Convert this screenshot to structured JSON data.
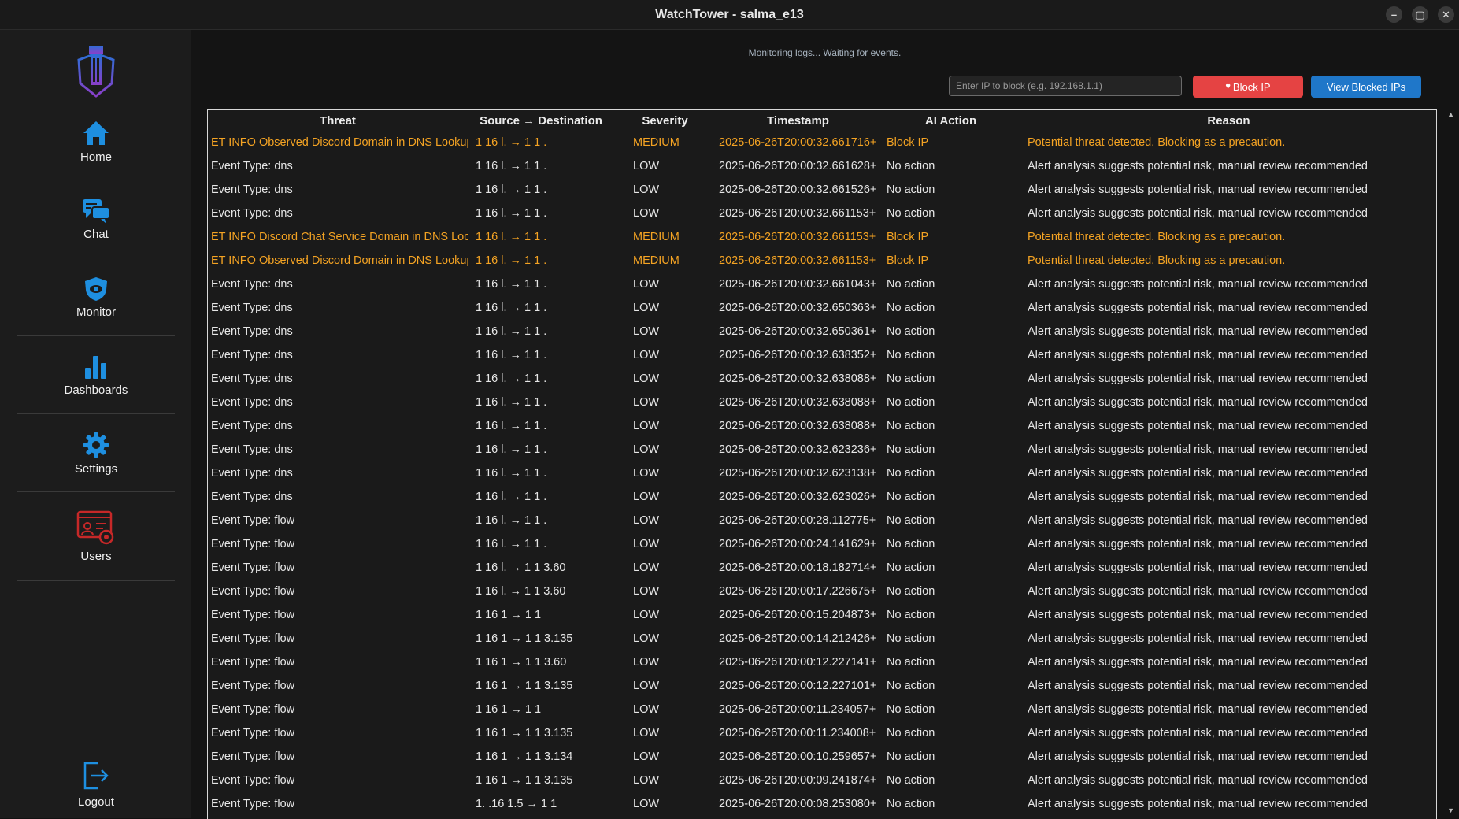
{
  "window": {
    "title": "WatchTower - salma_e13",
    "controls": [
      "–",
      "▢",
      "✕"
    ]
  },
  "sidebar": {
    "items": [
      {
        "label": "Home",
        "icon": "home-icon"
      },
      {
        "label": "Chat",
        "icon": "chat-icon"
      },
      {
        "label": "Monitor",
        "icon": "shield-eye-icon"
      },
      {
        "label": "Dashboards",
        "icon": "bar-chart-icon"
      },
      {
        "label": "Settings",
        "icon": "gear-icon"
      },
      {
        "label": "Users",
        "icon": "users-admin-icon"
      }
    ],
    "logout": {
      "label": "Logout",
      "icon": "logout-icon"
    }
  },
  "main": {
    "status": "Monitoring logs... Waiting for events.",
    "ip_input": {
      "placeholder": "Enter IP to block (e.g. 192.168.1.1)",
      "value": ""
    },
    "block_button": "Block IP",
    "view_button": "View Blocked IPs",
    "colors": {
      "medium": "#f4a323",
      "block": "#e54343",
      "view": "#1f77c9"
    }
  },
  "table": {
    "headers": [
      "Threat",
      "Source → Destination",
      "Severity",
      "Timestamp",
      "AI Action",
      "Reason"
    ],
    "rows": [
      {
        "threat": "ET INFO Observed Discord Domain in DNS Lookup",
        "src_dst": "1 16 l. → 1 1 .",
        "severity": "MEDIUM",
        "timestamp": "2025-06-26T20:00:32.661716+",
        "action": "Block IP",
        "reason": "Potential threat detected. Blocking as a precaution."
      },
      {
        "threat": "Event Type: dns",
        "src_dst": "1 16 l. → 1 1 .",
        "severity": "LOW",
        "timestamp": "2025-06-26T20:00:32.661628+",
        "action": "No action",
        "reason": "Alert analysis suggests potential risk, manual review recommended"
      },
      {
        "threat": "Event Type: dns",
        "src_dst": "1 16 l. → 1 1 .",
        "severity": "LOW",
        "timestamp": "2025-06-26T20:00:32.661526+",
        "action": "No action",
        "reason": "Alert analysis suggests potential risk, manual review recommended"
      },
      {
        "threat": "Event Type: dns",
        "src_dst": "1 16 l. → 1 1 .",
        "severity": "LOW",
        "timestamp": "2025-06-26T20:00:32.661153+",
        "action": "No action",
        "reason": "Alert analysis suggests potential risk, manual review recommended"
      },
      {
        "threat": "ET INFO Discord Chat Service Domain in DNS Lookup",
        "src_dst": "1 16 l. → 1 1 .",
        "severity": "MEDIUM",
        "timestamp": "2025-06-26T20:00:32.661153+",
        "action": "Block IP",
        "reason": "Potential threat detected. Blocking as a precaution."
      },
      {
        "threat": "ET INFO Observed Discord Domain in DNS Lookup",
        "src_dst": "1 16 l. → 1 1 .",
        "severity": "MEDIUM",
        "timestamp": "2025-06-26T20:00:32.661153+",
        "action": "Block IP",
        "reason": "Potential threat detected. Blocking as a precaution."
      },
      {
        "threat": "Event Type: dns",
        "src_dst": "1 16 l. → 1 1 .",
        "severity": "LOW",
        "timestamp": "2025-06-26T20:00:32.661043+",
        "action": "No action",
        "reason": "Alert analysis suggests potential risk, manual review recommended"
      },
      {
        "threat": "Event Type: dns",
        "src_dst": "1 16 l. → 1 1 .",
        "severity": "LOW",
        "timestamp": "2025-06-26T20:00:32.650363+",
        "action": "No action",
        "reason": "Alert analysis suggests potential risk, manual review recommended"
      },
      {
        "threat": "Event Type: dns",
        "src_dst": "1 16 l. → 1 1 .",
        "severity": "LOW",
        "timestamp": "2025-06-26T20:00:32.650361+",
        "action": "No action",
        "reason": "Alert analysis suggests potential risk, manual review recommended"
      },
      {
        "threat": "Event Type: dns",
        "src_dst": "1 16 l. → 1 1 .",
        "severity": "LOW",
        "timestamp": "2025-06-26T20:00:32.638352+",
        "action": "No action",
        "reason": "Alert analysis suggests potential risk, manual review recommended"
      },
      {
        "threat": "Event Type: dns",
        "src_dst": "1 16 l. → 1 1 .",
        "severity": "LOW",
        "timestamp": "2025-06-26T20:00:32.638088+",
        "action": "No action",
        "reason": "Alert analysis suggests potential risk, manual review recommended"
      },
      {
        "threat": "Event Type: dns",
        "src_dst": "1 16 l. → 1 1 .",
        "severity": "LOW",
        "timestamp": "2025-06-26T20:00:32.638088+",
        "action": "No action",
        "reason": "Alert analysis suggests potential risk, manual review recommended"
      },
      {
        "threat": "Event Type: dns",
        "src_dst": "1 16 l. → 1 1 .",
        "severity": "LOW",
        "timestamp": "2025-06-26T20:00:32.638088+",
        "action": "No action",
        "reason": "Alert analysis suggests potential risk, manual review recommended"
      },
      {
        "threat": "Event Type: dns",
        "src_dst": "1 16 l. → 1 1 .",
        "severity": "LOW",
        "timestamp": "2025-06-26T20:00:32.623236+",
        "action": "No action",
        "reason": "Alert analysis suggests potential risk, manual review recommended"
      },
      {
        "threat": "Event Type: dns",
        "src_dst": "1 16 l. → 1 1 .",
        "severity": "LOW",
        "timestamp": "2025-06-26T20:00:32.623138+",
        "action": "No action",
        "reason": "Alert analysis suggests potential risk, manual review recommended"
      },
      {
        "threat": "Event Type: dns",
        "src_dst": "1 16 l. → 1 1 .",
        "severity": "LOW",
        "timestamp": "2025-06-26T20:00:32.623026+",
        "action": "No action",
        "reason": "Alert analysis suggests potential risk, manual review recommended"
      },
      {
        "threat": "Event Type: flow",
        "src_dst": "1 16 l. → 1 1 .",
        "severity": "LOW",
        "timestamp": "2025-06-26T20:00:28.112775+",
        "action": "No action",
        "reason": "Alert analysis suggests potential risk, manual review recommended"
      },
      {
        "threat": "Event Type: flow",
        "src_dst": "1 16 l. → 1 1 .",
        "severity": "LOW",
        "timestamp": "2025-06-26T20:00:24.141629+",
        "action": "No action",
        "reason": "Alert analysis suggests potential risk, manual review recommended"
      },
      {
        "threat": "Event Type: flow",
        "src_dst": "1 16 l. → 1 1 3.60",
        "severity": "LOW",
        "timestamp": "2025-06-26T20:00:18.182714+",
        "action": "No action",
        "reason": "Alert analysis suggests potential risk, manual review recommended"
      },
      {
        "threat": "Event Type: flow",
        "src_dst": "1 16 l. → 1 1 3.60",
        "severity": "LOW",
        "timestamp": "2025-06-26T20:00:17.226675+",
        "action": "No action",
        "reason": "Alert analysis suggests potential risk, manual review recommended"
      },
      {
        "threat": "Event Type: flow",
        "src_dst": "1 16 1 → 1 1",
        "severity": "LOW",
        "timestamp": "2025-06-26T20:00:15.204873+",
        "action": "No action",
        "reason": "Alert analysis suggests potential risk, manual review recommended"
      },
      {
        "threat": "Event Type: flow",
        "src_dst": "1 16 1 → 1 1 3.135",
        "severity": "LOW",
        "timestamp": "2025-06-26T20:00:14.212426+",
        "action": "No action",
        "reason": "Alert analysis suggests potential risk, manual review recommended"
      },
      {
        "threat": "Event Type: flow",
        "src_dst": "1 16 1 → 1 1 3.60",
        "severity": "LOW",
        "timestamp": "2025-06-26T20:00:12.227141+",
        "action": "No action",
        "reason": "Alert analysis suggests potential risk, manual review recommended"
      },
      {
        "threat": "Event Type: flow",
        "src_dst": "1 16 1 → 1 1 3.135",
        "severity": "LOW",
        "timestamp": "2025-06-26T20:00:12.227101+",
        "action": "No action",
        "reason": "Alert analysis suggests potential risk, manual review recommended"
      },
      {
        "threat": "Event Type: flow",
        "src_dst": "1 16 1 → 1 1",
        "severity": "LOW",
        "timestamp": "2025-06-26T20:00:11.234057+",
        "action": "No action",
        "reason": "Alert analysis suggests potential risk, manual review recommended"
      },
      {
        "threat": "Event Type: flow",
        "src_dst": "1 16 1 → 1 1 3.135",
        "severity": "LOW",
        "timestamp": "2025-06-26T20:00:11.234008+",
        "action": "No action",
        "reason": "Alert analysis suggests potential risk, manual review recommended"
      },
      {
        "threat": "Event Type: flow",
        "src_dst": "1 16 1 → 1 1 3.134",
        "severity": "LOW",
        "timestamp": "2025-06-26T20:00:10.259657+",
        "action": "No action",
        "reason": "Alert analysis suggests potential risk, manual review recommended"
      },
      {
        "threat": "Event Type: flow",
        "src_dst": "1 16 1 → 1 1 3.135",
        "severity": "LOW",
        "timestamp": "2025-06-26T20:00:09.241874+",
        "action": "No action",
        "reason": "Alert analysis suggests potential risk, manual review recommended"
      },
      {
        "threat": "Event Type: flow",
        "src_dst": "1. .16 1.5 → 1 1",
        "severity": "LOW",
        "timestamp": "2025-06-26T20:00:08.253080+",
        "action": "No action",
        "reason": "Alert analysis suggests potential risk, manual review recommended"
      }
    ]
  }
}
